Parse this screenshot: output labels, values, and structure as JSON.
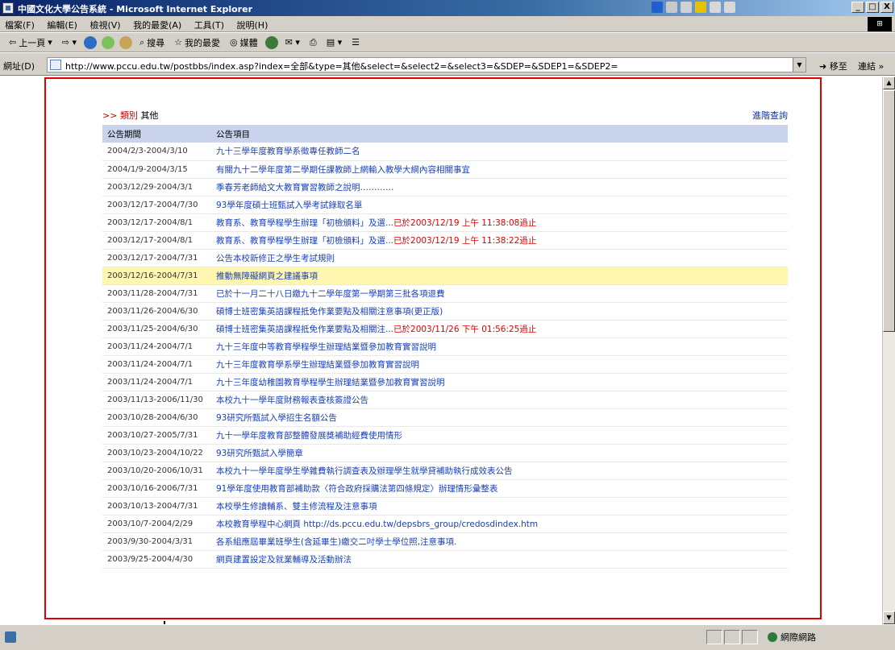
{
  "window": {
    "title": "中國文化大學公告系統 - Microsoft Internet Explorer",
    "controls": [
      "_",
      "□",
      "X"
    ]
  },
  "menu": [
    "檔案(F)",
    "編輯(E)",
    "檢視(V)",
    "我的最愛(A)",
    "工具(T)",
    "說明(H)"
  ],
  "toolbar": {
    "back": "上一頁",
    "search": "搜尋",
    "favorites": "我的最愛",
    "media": "媒體"
  },
  "address": {
    "label": "網址(D)",
    "url": "http://www.pccu.edu.tw/postbbs/index.asp?index=全部&type=其他&select=&select2=&select3=&SDEP=&SDEP1=&SDEP2=",
    "go": "移至",
    "links": "連結"
  },
  "content": {
    "breadcrumb_marker": ">>",
    "category_key": "類別",
    "category_value": "其他",
    "advanced_search": "進階查詢",
    "columns": [
      "公告期間",
      "公告項目"
    ],
    "rows": [
      {
        "period": "2004/2/3-2004/3/10",
        "item": "九十三學年度教育學系徵專任教師二名",
        "expired": ""
      },
      {
        "period": "2004/1/9-2004/3/15",
        "item": "有關九十二學年度第二學期任課教師上網輸入教學大綱內容相關事宜",
        "expired": ""
      },
      {
        "period": "2003/12/29-2004/3/1",
        "item": "季春芳老師給文大教育實習教師之說明…………",
        "expired": ""
      },
      {
        "period": "2003/12/17-2004/7/30",
        "item": "93學年度碩士班甄試入學考試錄取名單",
        "expired": ""
      },
      {
        "period": "2003/12/17-2004/8/1",
        "item": "教育系、教育學程學生辦理「初檢頒料」及選...",
        "expired": "已於2003/12/19 上午 11:38:08過止"
      },
      {
        "period": "2003/12/17-2004/8/1",
        "item": "教育系、教育學程學生辦理「初檢頒料」及選...",
        "expired": "已於2003/12/19 上午 11:38:22過止"
      },
      {
        "period": "2003/12/17-2004/7/31",
        "item": "公告本校新修正之學生考試規則",
        "expired": ""
      },
      {
        "period": "2003/12/16-2004/7/31",
        "item": "推動無障礙網頁之建議事項",
        "expired": "",
        "highlight": true
      },
      {
        "period": "2003/11/28-2004/7/31",
        "item": "已於十一月二十八日繳九十二學年度第一學期第三批各項退費",
        "expired": ""
      },
      {
        "period": "2003/11/26-2004/6/30",
        "item": "碩博士班密集英語課程抵免作業要點及相關注意事項(更正版)",
        "expired": ""
      },
      {
        "period": "2003/11/25-2004/6/30",
        "item": "碩博士班密集英語課程抵免作業要點及相關注...",
        "expired": "已於2003/11/26 下午 01:56:25過止"
      },
      {
        "period": "2003/11/24-2004/7/1",
        "item": "九十三年度中等教育學程學生辦理結業暨參加教育實習說明",
        "expired": ""
      },
      {
        "period": "2003/11/24-2004/7/1",
        "item": "九十三年度教育學系學生辦理結業暨參加教育實習說明",
        "expired": ""
      },
      {
        "period": "2003/11/24-2004/7/1",
        "item": "九十三年度幼稚園教育學程學生辦理結業暨參加教育實習說明",
        "expired": ""
      },
      {
        "period": "2003/11/13-2006/11/30",
        "item": "本校九十一學年度財務報表查核簽證公告",
        "expired": ""
      },
      {
        "period": "2003/10/28-2004/6/30",
        "item": "93研究所甄試入學招生名額公告",
        "expired": ""
      },
      {
        "period": "2003/10/27-2005/7/31",
        "item": "九十一學年度教育部整體發展獎補助經費使用情形",
        "expired": ""
      },
      {
        "period": "2003/10/23-2004/10/22",
        "item": "93研究所甄試入學簡章",
        "expired": ""
      },
      {
        "period": "2003/10/20-2006/10/31",
        "item": "本校九十一學年度學生學雜費執行調查表及辦理學生就學貸補助執行成效表公告",
        "expired": ""
      },
      {
        "period": "2003/10/16-2006/7/31",
        "item": "91學年度使用教育部補助款〈符合政府採購法第四條規定〉辦理情形彙整表",
        "expired": ""
      },
      {
        "period": "2003/10/13-2004/7/31",
        "item": "本校學生修讀輔系、雙主修流程及注意事項",
        "expired": ""
      },
      {
        "period": "2003/10/7-2004/2/29",
        "item": "本校教育學程中心網頁 http://ds.pccu.edu.tw/depsbrs_group/credosdindex.htm",
        "expired": ""
      },
      {
        "period": "2003/9/30-2004/3/31",
        "item": "各系組應屆畢業班學生(含延畢生)繳交二吋學士學位照,注意事項.",
        "expired": ""
      },
      {
        "period": "2003/9/25-2004/4/30",
        "item": "網頁建置設定及就業輔導及活動辦法",
        "expired": ""
      }
    ]
  },
  "status": {
    "zone": "網際網路"
  },
  "colors": {
    "link": "#1a3fb3",
    "expired": "#e00000",
    "header_bg": "#c9d3ec",
    "highlight_bg": "#fff7b0",
    "annotation": "#e00000"
  }
}
